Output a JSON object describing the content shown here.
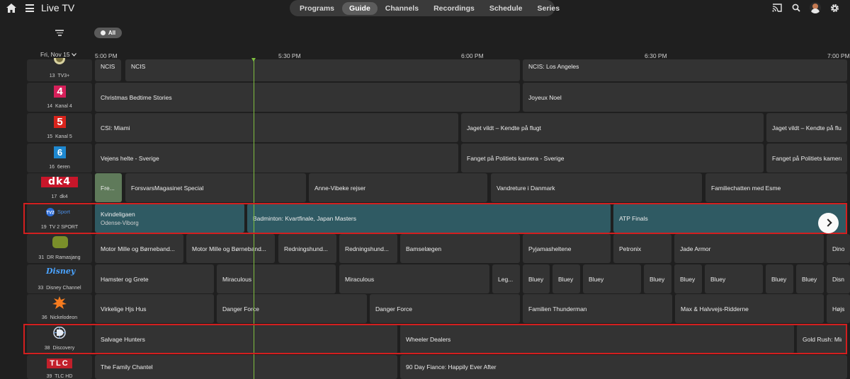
{
  "header": {
    "title": "Live TV",
    "tabs": [
      "Programs",
      "Guide",
      "Channels",
      "Recordings",
      "Schedule",
      "Series"
    ],
    "active_tab": "Guide"
  },
  "filter": {
    "chip_label": "All"
  },
  "timeline": {
    "date": "Fri, Nov 15",
    "times": [
      "5:00 PM",
      "5:30 PM",
      "6:00 PM",
      "6:30 PM",
      "7:00 PM"
    ]
  },
  "colors": {
    "highlight": "#d21f1f",
    "now_line": "#7fbf3f",
    "teal_program": "#2f5a63"
  },
  "channels": [
    {
      "num": "13",
      "name": "TV3+",
      "logo": "tv3plus-logo",
      "programs": [
        {
          "t": "NCIS"
        },
        {
          "t": "NCIS"
        },
        {
          "t": "NCIS: Los Angeles"
        }
      ]
    },
    {
      "num": "14",
      "name": "Kanal 4",
      "logo": "kanal4-logo",
      "programs": [
        {
          "t": "Christmas Bedtime Stories"
        },
        {
          "t": "Joyeux Noel"
        }
      ]
    },
    {
      "num": "15",
      "name": "Kanal 5",
      "logo": "kanal5-logo",
      "programs": [
        {
          "t": "CSI: Miami"
        },
        {
          "t": "Jaget vildt – Kendte på flugt"
        },
        {
          "t": "Jaget vildt – Kendte på flugt"
        }
      ]
    },
    {
      "num": "16",
      "name": "6eren",
      "logo": "6eren-logo",
      "programs": [
        {
          "t": "Vejens helte - Sverige"
        },
        {
          "t": "Fanget på Politiets kamera - Sverige"
        },
        {
          "t": "Fanget på Politiets kamera"
        }
      ]
    },
    {
      "num": "17",
      "name": "dk4",
      "logo": "dk4-logo",
      "programs": [
        {
          "t": "Fre..."
        },
        {
          "t": "ForsvarsMagasinet Special"
        },
        {
          "t": "Anne-Vibeke rejser"
        },
        {
          "t": "Vandreture i Danmark"
        },
        {
          "t": "Familiechatten med Esme"
        }
      ]
    },
    {
      "num": "19",
      "name": "TV 2 SPORT",
      "logo": "tv2sport-logo",
      "logo_text": "Sport",
      "programs": [
        {
          "t": "Kvindeligaen",
          "s": "Odense-Viborg"
        },
        {
          "t": "Badminton: Kvartfinale, Japan Masters"
        },
        {
          "t": "ATP Finals"
        }
      ]
    },
    {
      "num": "31",
      "name": "DR Ramasjang",
      "logo": "ramasjang-logo",
      "programs": [
        {
          "t": "Motor Mille og Børneband..."
        },
        {
          "t": "Motor Mille og Børneband..."
        },
        {
          "t": "Redningshund..."
        },
        {
          "t": "Redningshund..."
        },
        {
          "t": "Bamselægen"
        },
        {
          "t": "Pyjamasheltene"
        },
        {
          "t": "Petronix"
        },
        {
          "t": "Jade Armor"
        },
        {
          "t": "Dino-"
        }
      ]
    },
    {
      "num": "33",
      "name": "Disney Channel",
      "logo": "disney-channel-logo",
      "programs": [
        {
          "t": "Hamster og Grete"
        },
        {
          "t": "Miraculous"
        },
        {
          "t": "Miraculous"
        },
        {
          "t": "Leg..."
        },
        {
          "t": "Bluey"
        },
        {
          "t": "Bluey"
        },
        {
          "t": "Bluey"
        },
        {
          "t": "Bluey"
        },
        {
          "t": "Bluey"
        },
        {
          "t": "Bluey"
        },
        {
          "t": "Bluey"
        },
        {
          "t": "Bluey"
        },
        {
          "t": "Disne"
        }
      ]
    },
    {
      "num": "36",
      "name": "Nickelodeon",
      "logo": "nickelodeon-logo",
      "programs": [
        {
          "t": "Virkelige Hjs Hus"
        },
        {
          "t": "Danger Force"
        },
        {
          "t": "Danger Force"
        },
        {
          "t": "Familien Thunderman"
        },
        {
          "t": "Max & Halvvejs-Ridderne"
        },
        {
          "t": "Højs"
        }
      ]
    },
    {
      "num": "38",
      "name": "Discovery",
      "logo": "discovery-logo",
      "programs": [
        {
          "t": "Salvage Hunters"
        },
        {
          "t": "Wheeler Dealers"
        },
        {
          "t": "Gold Rush: Mine"
        }
      ]
    },
    {
      "num": "39",
      "name": "TLC HD",
      "logo": "tlc-logo",
      "logo_text": "TLC",
      "programs": [
        {
          "t": "The Family Chantel"
        },
        {
          "t": "90 Day Fiance: Happily Ever After"
        }
      ]
    }
  ]
}
